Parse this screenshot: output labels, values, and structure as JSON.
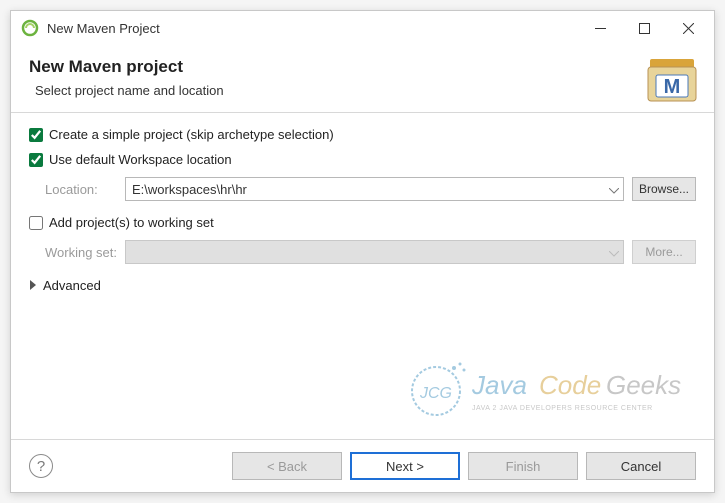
{
  "window": {
    "title": "New Maven Project"
  },
  "header": {
    "heading": "New Maven project",
    "subtitle": "Select project name and location"
  },
  "content": {
    "simpleProjectLabel": "Create a simple project (skip archetype selection)",
    "defaultWorkspaceLabel": "Use default Workspace location",
    "locationLabel": "Location:",
    "locationValue": "E:\\workspaces\\hr\\hr",
    "browseLabel": "Browse...",
    "addToWorkingSetLabel": "Add project(s) to working set",
    "workingSetLabel": "Working set:",
    "workingSetValue": "",
    "moreLabel": "More...",
    "advancedLabel": "Advanced"
  },
  "watermark": {
    "text1": "Java",
    "text2": "Code",
    "text3": "Geeks",
    "sub": "JAVA 2 JAVA DEVELOPERS RESOURCE CENTER"
  },
  "footer": {
    "help": "?",
    "back": "< Back",
    "next": "Next >",
    "finish": "Finish",
    "cancel": "Cancel"
  }
}
